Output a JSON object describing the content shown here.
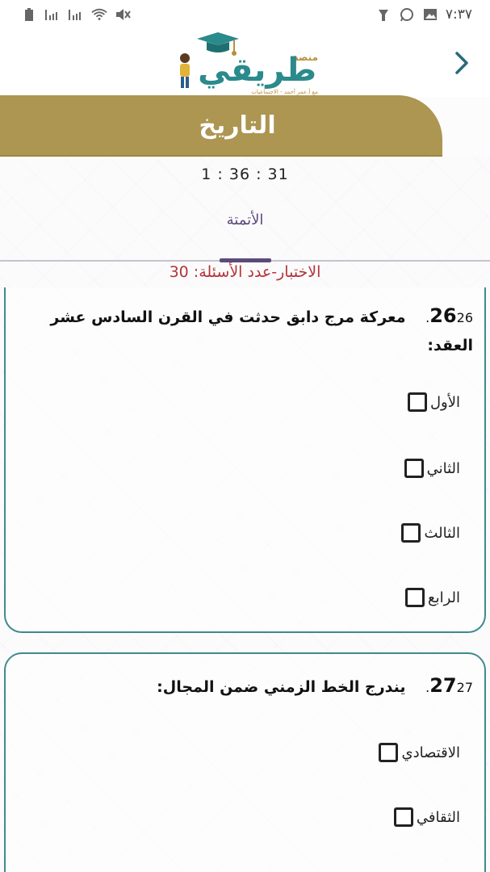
{
  "status_bar": {
    "time": "٧:٣٧",
    "icons": [
      "battery-icon",
      "signal-icon",
      "signal-icon",
      "wifi-icon",
      "mute-icon",
      "torch-icon",
      "whatsapp-icon",
      "gallery-icon"
    ]
  },
  "header": {
    "logo_text": "طريقي",
    "logo_small": "منصة",
    "logo_tagline": "مع أ.عمر أحمد - الاجتماعيات",
    "back_icon": "chevron-right-icon"
  },
  "subject": {
    "title": "التاريخ"
  },
  "timer": {
    "display": "1 : 36 : 31"
  },
  "quiz_type": "الأتمتة",
  "question_count_text": "الاختبار-عدد الأسئلة: 30",
  "questions": [
    {
      "big_number": "26",
      "small_number": "26.",
      "text": "معركة مرج دابق حدثت في القرن السادس عشر العقد:",
      "options": [
        "الأول",
        "الثاني",
        "الثالث",
        "الرابع"
      ]
    },
    {
      "big_number": "27",
      "small_number": "27.",
      "text": "يندرج الخط الزمني ضمن المجال:",
      "options": [
        "الاقتصادي",
        "الثقافي"
      ]
    }
  ],
  "colors": {
    "banner": "#ad9552",
    "card_border": "#3e8a8e",
    "count_text": "#b3343a",
    "quiz_type": "#5a4b7a"
  }
}
